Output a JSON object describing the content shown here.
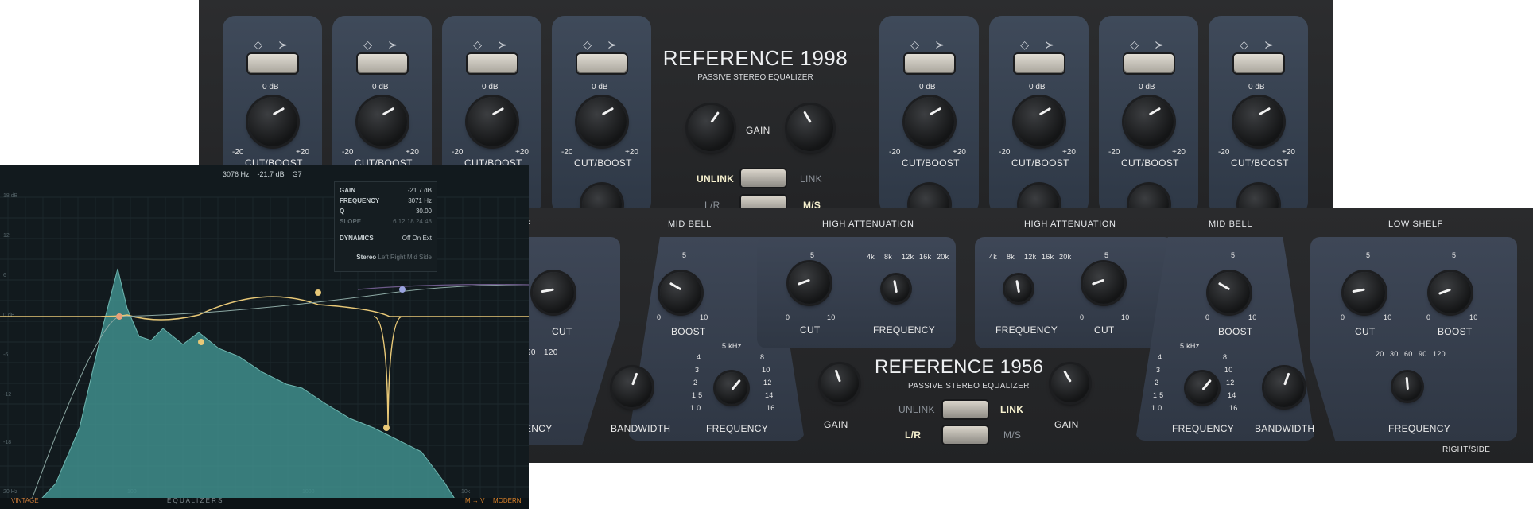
{
  "ref1998": {
    "title": "REFERENCE 1998",
    "subtitle": "PASSIVE STEREO EQUALIZER",
    "gain_label": "GAIN",
    "unlink": "UNLINK",
    "link": "LINK",
    "lr": "L/R",
    "ms": "M/S",
    "db_label": "0 dB",
    "min": "-20",
    "max": "+20",
    "cutboost": "CUT/BOOST"
  },
  "ref1956": {
    "title": "REFERENCE 1956",
    "subtitle": "PASSIVE STEREO EQUALIZER",
    "sections": {
      "low_shelf_left": "LF",
      "mid_bell_left": "MID BELL",
      "high_att_left": "HIGH ATTENUATION",
      "high_att_right": "HIGH ATTENUATION",
      "mid_bell_right": "MID BELL",
      "low_shelf_right": "LOW SHELF"
    },
    "labels": {
      "cut": "CUT",
      "boost": "BOOST",
      "frequency": "FREQUENCY",
      "bandwidth": "BANDWIDTH",
      "gain": "GAIN",
      "unlink": "UNLINK",
      "link": "LINK",
      "lr": "L/R",
      "ms": "M/S",
      "right_side": "RIGHT/SIDE",
      "partial_freq": "ENCY",
      "partial_90": "90",
      "partial_120": "120",
      "zero": "0",
      "five": "5",
      "ten": "10"
    },
    "hf_freqs": [
      "4k",
      "8k",
      "12k",
      "16k",
      "20k"
    ],
    "mid_freqs_left": [
      "5 kHz",
      "4",
      "3",
      "2",
      "1.5",
      "1.0",
      "8",
      "10",
      "12",
      "14",
      "16"
    ],
    "low_freqs": [
      "20",
      "30",
      "60",
      "90",
      "120"
    ]
  },
  "equalizer": {
    "top_readout": [
      "3076 Hz",
      "-21.7 dB",
      "G7"
    ],
    "info": {
      "gain_label": "GAIN",
      "gain_value": "-21.7 dB",
      "freq_label": "FREQUENCY",
      "freq_value": "3071 Hz",
      "q_label": "Q",
      "q_value": "30.00",
      "slope_label": "SLOPE",
      "slope_values": "6  12  18  24  48",
      "dyn_label": "DYNAMICS",
      "dyn_value": "Off  On  Ext",
      "stereo": "Stereo",
      "stereo_opts": "Left  Right  Mid  Side"
    },
    "y_labels": [
      "18 dB",
      "12",
      "6",
      "0 dB",
      "-6",
      "-12",
      "-18"
    ],
    "x_labels": [
      "20 Hz",
      "100",
      "1000",
      "10k"
    ],
    "footer_left": "VINTAGE",
    "footer_center": "E Q U A L I Z E R S",
    "footer_mode": "M → V",
    "footer_right": "MODERN",
    "colors": {
      "accent": "#e8c877",
      "spectrum": "#3f8e8c",
      "bg": "#121a1e"
    }
  }
}
